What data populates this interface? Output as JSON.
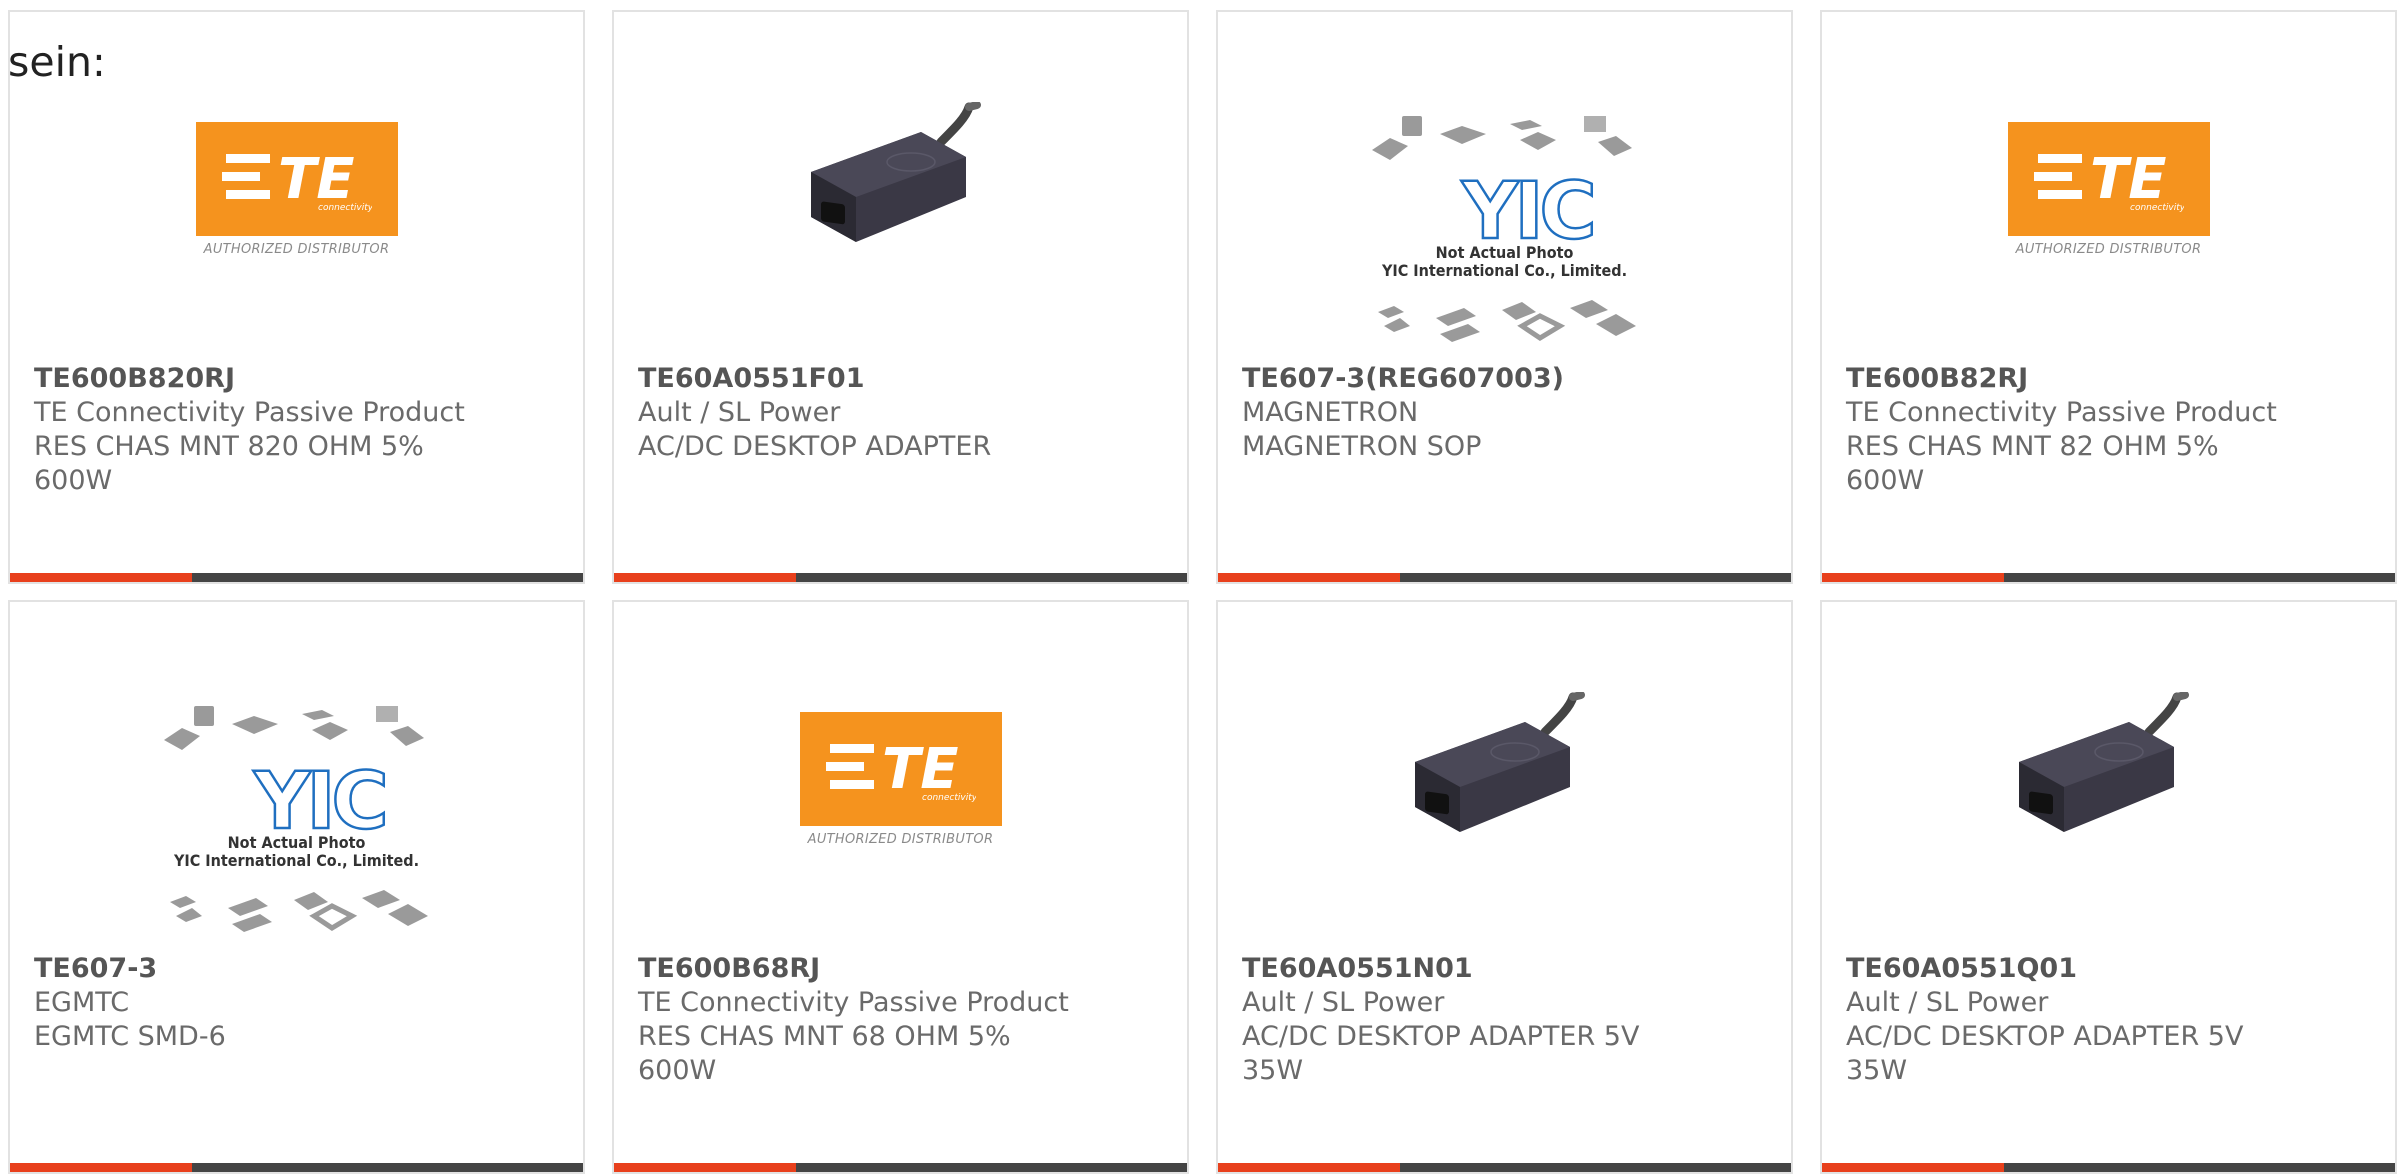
{
  "lead_text": "sein:",
  "logo_text": {
    "te_mark": "TE",
    "te_sub": "connectivity",
    "te_distributor": "AUTHORIZED DISTRIBUTOR",
    "yic_mark": "YIC"
  },
  "placeholder_text": {
    "line1": "Not Actual Photo",
    "line2": "YIC International Co., Limited."
  },
  "colors": {
    "accent": "#e8401c",
    "bar": "#444444",
    "te_orange": "#f5931e",
    "yic_blue": "#1f6fc0"
  },
  "products": [
    {
      "part": "TE600B820RJ",
      "manufacturer": "TE Connectivity Passive Product",
      "description": "RES CHAS MNT 820 OHM 5% 600W",
      "image": "te-logo"
    },
    {
      "part": "TE60A0551F01",
      "manufacturer": "Ault / SL Power",
      "description": "AC/DC DESKTOP ADAPTER",
      "image": "adapter-photo"
    },
    {
      "part": "TE607-3(REG607003)",
      "manufacturer": "MAGNETRON",
      "description": "MAGNETRON SOP",
      "image": "yic-placeholder"
    },
    {
      "part": "TE600B82RJ",
      "manufacturer": "TE Connectivity Passive Product",
      "description": "RES CHAS MNT 82 OHM 5% 600W",
      "image": "te-logo"
    },
    {
      "part": "TE607-3",
      "manufacturer": "EGMTC",
      "description": "EGMTC SMD-6",
      "image": "yic-placeholder"
    },
    {
      "part": "TE600B68RJ",
      "manufacturer": "TE Connectivity Passive Product",
      "description": "RES CHAS MNT 68 OHM 5% 600W",
      "image": "te-logo"
    },
    {
      "part": "TE60A0551N01",
      "manufacturer": "Ault / SL Power",
      "description": "AC/DC DESKTOP ADAPTER 5V 35W",
      "image": "adapter-photo"
    },
    {
      "part": "TE60A0551Q01",
      "manufacturer": "Ault / SL Power",
      "description": "AC/DC DESKTOP ADAPTER 5V 35W",
      "image": "adapter-photo"
    }
  ]
}
